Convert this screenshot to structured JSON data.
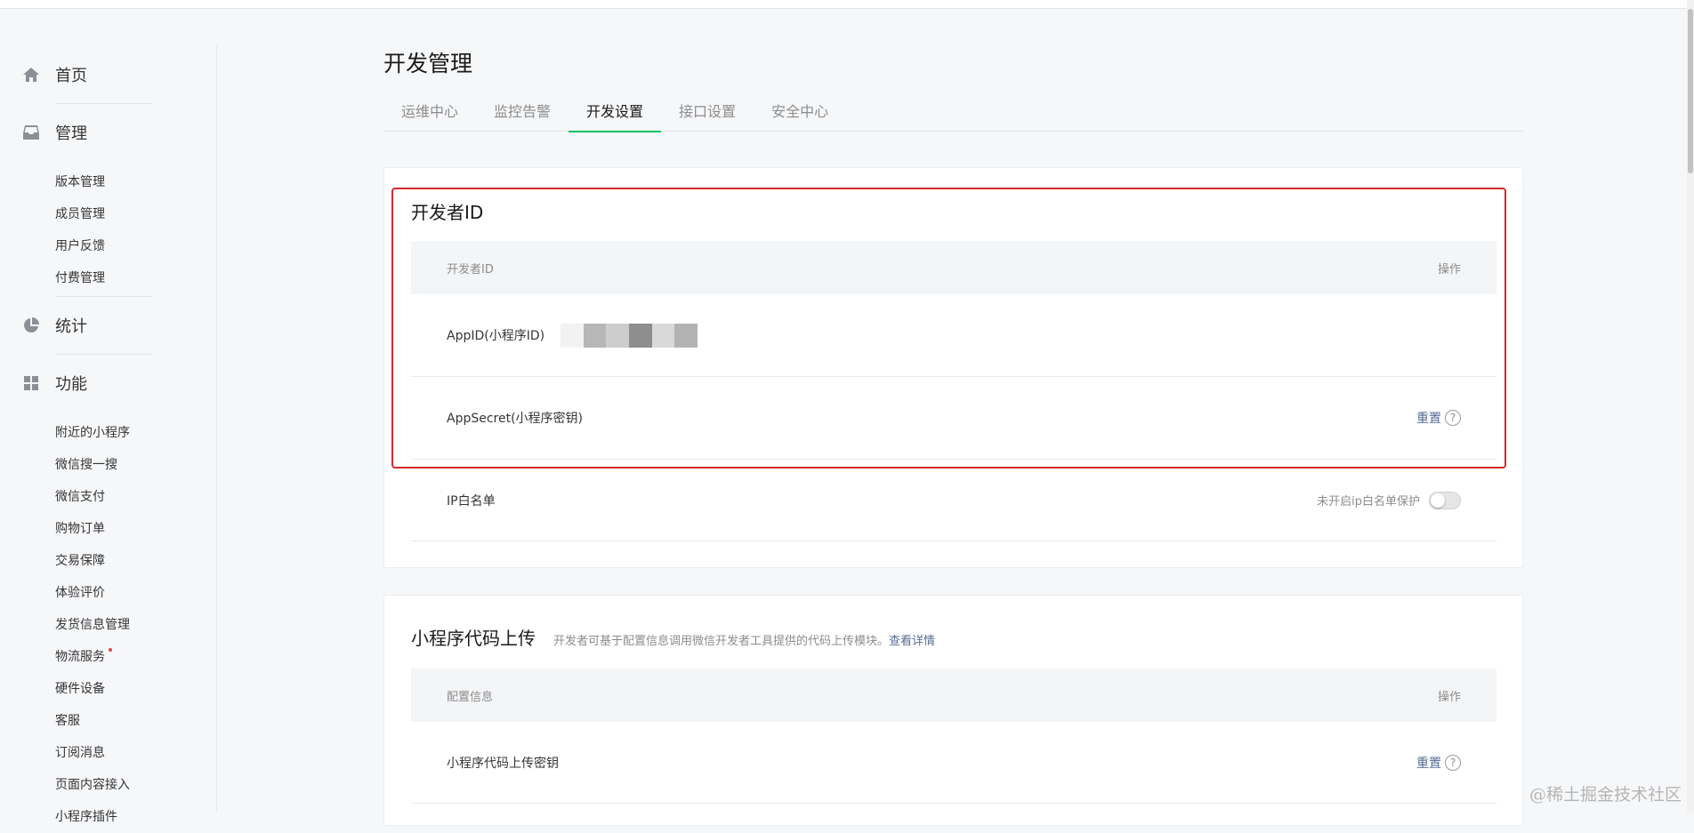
{
  "sidebar": {
    "home": {
      "label": "首页",
      "icon": "home-icon"
    },
    "manage": {
      "label": "管理",
      "icon": "inbox-icon",
      "items": [
        "版本管理",
        "成员管理",
        "用户反馈",
        "付费管理"
      ]
    },
    "stats": {
      "label": "统计",
      "icon": "pie-chart-icon"
    },
    "features": {
      "label": "功能",
      "icon": "grid-icon",
      "items": [
        "附近的小程序",
        "微信搜一搜",
        "微信支付",
        "购物订单",
        "交易保障",
        "体验评价",
        "发货信息管理",
        "物流服务",
        "硬件设备",
        "客服",
        "订阅消息",
        "页面内容接入",
        "小程序插件"
      ]
    }
  },
  "page": {
    "title": "开发管理",
    "tabs": [
      "运维中心",
      "监控告警",
      "开发设置",
      "接口设置",
      "安全中心"
    ],
    "active_tab": "开发设置"
  },
  "dev_id_card": {
    "title": "开发者ID",
    "header_left": "开发者ID",
    "header_right": "操作",
    "rows": {
      "appid_label": "AppID(小程序ID)",
      "appsecret_label": "AppSecret(小程序密钥)",
      "appsecret_action": "重置",
      "ip_label": "IP白名单",
      "ip_status": "未开启ip白名单保护"
    }
  },
  "upload_card": {
    "title": "小程序代码上传",
    "desc": "开发者可基于配置信息调用微信开发者工具提供的代码上传模块。",
    "desc_link": "查看详情",
    "header_left": "配置信息",
    "header_right": "操作",
    "row_label": "小程序代码上传密钥",
    "row_action": "重置"
  },
  "watermark": "@稀土掘金技术社区",
  "colors": {
    "accent": "#07c160",
    "link": "#576b95",
    "highlight": "#d62a2a"
  }
}
